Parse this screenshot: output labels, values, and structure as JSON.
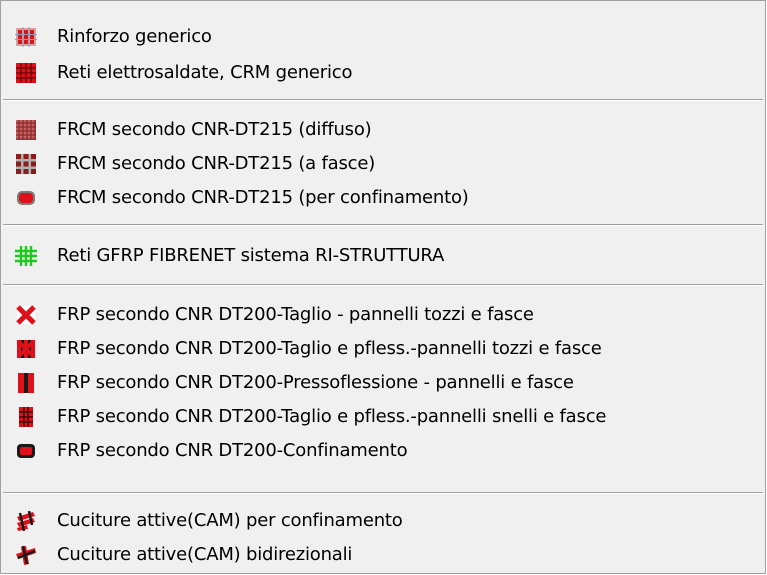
{
  "menu": {
    "items": [
      {
        "label": "Rinforzo generico",
        "icon": "generic-reinforcement-icon"
      },
      {
        "label": "Reti elettrosaldate, CRM generico",
        "icon": "welded-mesh-icon"
      },
      {
        "label": "FRCM secondo CNR-DT215 (diffuso)",
        "icon": "frcm-diffuse-icon"
      },
      {
        "label": "FRCM secondo CNR-DT215 (a fasce)",
        "icon": "frcm-strips-icon"
      },
      {
        "label": "FRCM secondo CNR-DT215 (per confinamento)",
        "icon": "frcm-confinement-icon"
      },
      {
        "label": "Reti GFRP FIBRENET sistema RI-STRUTTURA",
        "icon": "gfrp-mesh-icon"
      },
      {
        "label": "FRP secondo CNR DT200-Taglio - pannelli tozzi e fasce",
        "icon": "frp-shear-icon"
      },
      {
        "label": "FRP secondo CNR DT200-Taglio e pfless.-pannelli tozzi e fasce",
        "icon": "frp-shear-bending-icon"
      },
      {
        "label": "FRP secondo CNR DT200-Pressoflessione - pannelli e fasce",
        "icon": "frp-bending-icon"
      },
      {
        "label": "FRP secondo CNR DT200-Taglio e pfless.-pannelli snelli e fasce",
        "icon": "frp-shear-bending-slender-icon"
      },
      {
        "label": "FRP secondo CNR DT200-Confinamento",
        "icon": "frp-confinement-icon"
      },
      {
        "label": "Cuciture attive(CAM) per confinamento",
        "icon": "cam-confinement-icon"
      },
      {
        "label": "Cuciture attive(CAM) bidirezionali",
        "icon": "cam-bidirectional-icon"
      }
    ]
  },
  "colors": {
    "menu_background": "#f0f0f0",
    "reinforcement_red": "#e0101a",
    "dark_red": "#8b1a1a",
    "mesh_green": "#1ec81e"
  }
}
